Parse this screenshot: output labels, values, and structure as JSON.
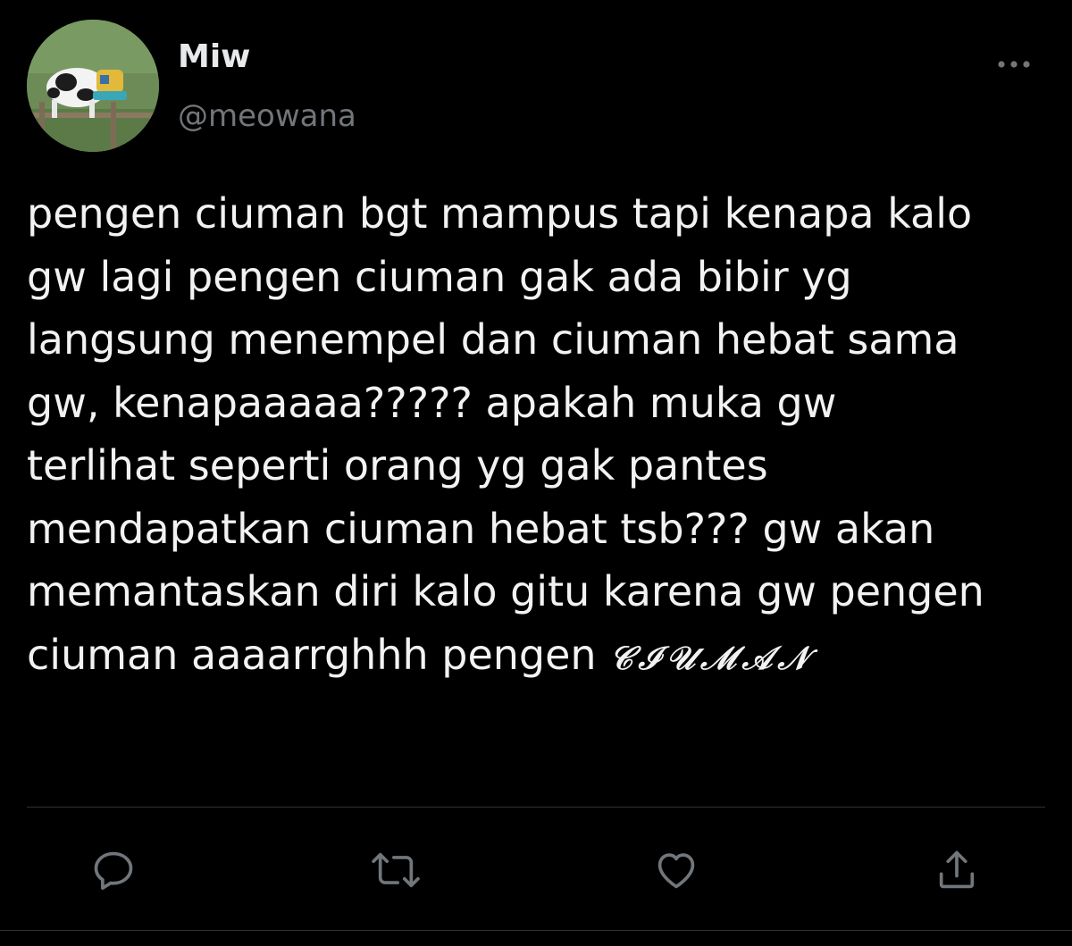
{
  "tweet": {
    "author_name": "Miw",
    "author_handle": "@meowana",
    "text_lines": [
      "pengen ciuman bgt mampus tapi kenapa kalo",
      "gw lagi pengen ciuman gak ada bibir yg",
      "langsung menempel dan ciuman hebat sama",
      "gw, kenapaaaaa????? apakah muka gw",
      "terlihat seperti orang yg gak pantes",
      "mendapatkan ciuman hebat tsb??? gw akan",
      "memantaskan diri kalo gitu karena gw pengen",
      "ciuman aaaarrghhh pengen "
    ],
    "fancy_word": "𝒞ℐ𝒰ℳ𝒜𝒩"
  },
  "icons": {
    "more": "more-dots-icon",
    "reply": "reply-bubble-icon",
    "retweet": "retweet-icon",
    "like": "heart-icon",
    "share": "share-upload-icon"
  },
  "colors": {
    "background": "#000000",
    "text": "#f2f2f2",
    "handle": "#71767b",
    "icon": "#71767b",
    "divider": "#2f3336"
  }
}
